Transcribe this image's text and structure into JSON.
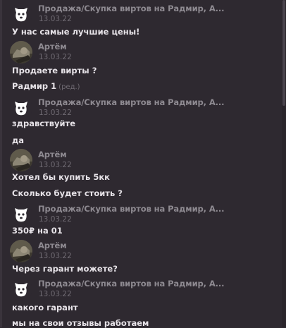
{
  "colors": {
    "background": "#2e2930",
    "text": "#e7e3e8",
    "author": "#8e8a91",
    "time": "#6f6a72"
  },
  "messages": [
    {
      "author": "Продажа/Скупка виртов на Радмир, А...",
      "time": "13.03.22",
      "avatar": "vk-logo-icon",
      "lines": [
        "У нас самые лучшие цены!"
      ]
    },
    {
      "author": "Артём",
      "time": "13.03.22",
      "avatar": "user-photo",
      "lines": [
        "Продаете вирты ?",
        "Радмир 1"
      ],
      "edited_label": "(ред.)"
    },
    {
      "author": "Продажа/Скупка виртов на Радмир, А...",
      "time": "13.03.22",
      "avatar": "vk-logo-icon",
      "lines": [
        "здравствуйте",
        "да"
      ]
    },
    {
      "author": "Артём",
      "time": "13.03.22",
      "avatar": "user-photo",
      "lines": [
        "Хотел бы купить 5кк",
        "Сколько будет стоить ?"
      ]
    },
    {
      "author": "Продажа/Скупка виртов на Радмир, А...",
      "time": "13.03.22",
      "avatar": "vk-logo-icon",
      "lines": [
        "350₽ на 01"
      ]
    },
    {
      "author": "Артём",
      "time": "13.03.22",
      "avatar": "user-photo",
      "lines": [
        "Через гарант можете?"
      ]
    },
    {
      "author": "Продажа/Скупка виртов на Радмир, А...",
      "time": "13.03.22",
      "avatar": "vk-logo-icon",
      "lines": [
        "какого гарант",
        "мы на свои отзывы работаем"
      ]
    }
  ]
}
